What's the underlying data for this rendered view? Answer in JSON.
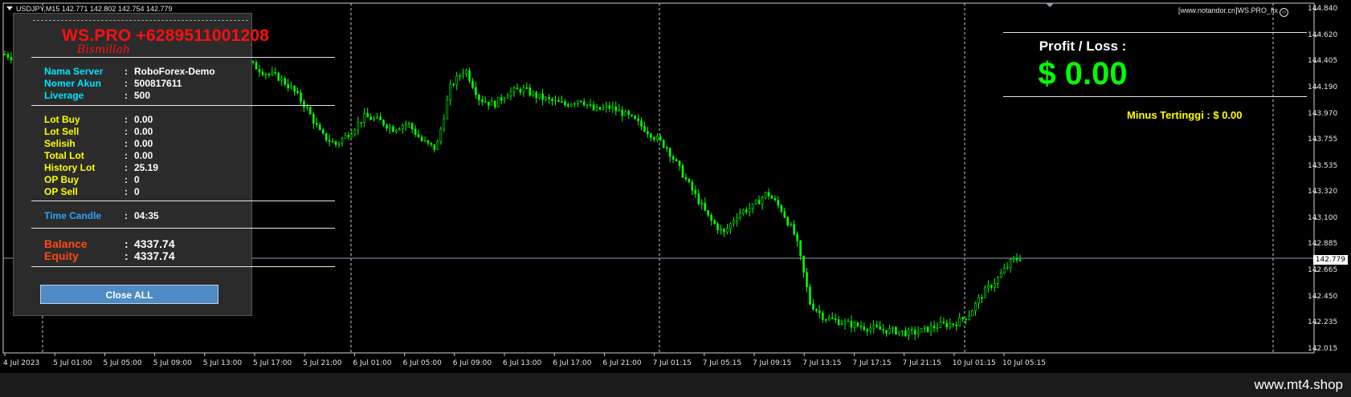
{
  "chart": {
    "symbol_info": "USDJPY,M15  142.771 142.802 142.754 142.779",
    "brand": "[www.notandor.cn]WS.PRO_fix",
    "current_price": "142.779",
    "price_axis": [
      "144.840",
      "144.620",
      "144.405",
      "144.190",
      "143.970",
      "143.755",
      "143.535",
      "143.320",
      "143.100",
      "142.885",
      "142.665",
      "142.450",
      "142.235",
      "142.015"
    ],
    "time_axis": [
      "4 Jul 2023",
      "5 Jul 01:00",
      "5 Jul 05:00",
      "5 Jul 09:00",
      "5 Jul 13:00",
      "5 Jul 17:00",
      "5 Jul 21:00",
      "6 Jul 01:00",
      "6 Jul 05:00",
      "6 Jul 09:00",
      "6 Jul 13:00",
      "6 Jul 17:00",
      "6 Jul 21:00",
      "7 Jul 01:15",
      "7 Jul 05:15",
      "7 Jul 09:15",
      "7 Jul 13:15",
      "7 Jul 17:15",
      "7 Jul 21:15",
      "10 Jul 01:15",
      "10 Jul 05:15"
    ],
    "price_range": [
      142.015,
      144.84
    ],
    "candle_color": "#00ff00",
    "background": "#000000",
    "price_path": [
      [
        0,
        144.47
      ],
      [
        5,
        144.42
      ],
      [
        10,
        144.43
      ],
      [
        15,
        144.38
      ],
      [
        20,
        144.3
      ],
      [
        25,
        144.2
      ],
      [
        30,
        144.28
      ],
      [
        35,
        144.52
      ],
      [
        40,
        144.6
      ],
      [
        45,
        144.62
      ],
      [
        50,
        144.65
      ],
      [
        55,
        144.7
      ],
      [
        60,
        144.66
      ],
      [
        65,
        144.6
      ],
      [
        70,
        144.55
      ],
      [
        75,
        144.58
      ],
      [
        80,
        144.5
      ],
      [
        85,
        144.4
      ],
      [
        90,
        144.32
      ],
      [
        95,
        144.28
      ],
      [
        100,
        144.18
      ],
      [
        105,
        144.02
      ],
      [
        110,
        143.8
      ],
      [
        115,
        143.72
      ],
      [
        120,
        143.82
      ],
      [
        125,
        143.95
      ],
      [
        130,
        143.92
      ],
      [
        135,
        143.85
      ],
      [
        140,
        143.9
      ],
      [
        145,
        143.75
      ],
      [
        150,
        143.68
      ],
      [
        155,
        144.2
      ],
      [
        160,
        144.35
      ],
      [
        165,
        144.1
      ],
      [
        170,
        144.05
      ],
      [
        175,
        144.15
      ],
      [
        180,
        144.18
      ],
      [
        185,
        144.12
      ],
      [
        190,
        144.08
      ],
      [
        195,
        144.05
      ],
      [
        200,
        144.1
      ],
      [
        205,
        144.0
      ],
      [
        210,
        144.03
      ],
      [
        215,
        143.98
      ],
      [
        220,
        143.9
      ],
      [
        225,
        143.8
      ],
      [
        230,
        143.7
      ],
      [
        235,
        143.5
      ],
      [
        240,
        143.3
      ],
      [
        245,
        143.1
      ],
      [
        250,
        142.98
      ],
      [
        255,
        143.15
      ],
      [
        260,
        143.2
      ],
      [
        265,
        143.32
      ],
      [
        270,
        143.18
      ],
      [
        275,
        142.95
      ],
      [
        280,
        142.4
      ],
      [
        285,
        142.28
      ],
      [
        290,
        142.25
      ],
      [
        295,
        142.22
      ],
      [
        300,
        142.2
      ],
      [
        305,
        142.18
      ],
      [
        310,
        142.17
      ],
      [
        315,
        142.15
      ],
      [
        320,
        142.18
      ],
      [
        325,
        142.22
      ],
      [
        330,
        142.23
      ],
      [
        335,
        142.3
      ],
      [
        340,
        142.48
      ],
      [
        345,
        142.6
      ],
      [
        350,
        142.75
      ],
      [
        353,
        142.78
      ]
    ]
  },
  "panel": {
    "title": "WS.PRO +6289511001208",
    "subtitle": "Bismillah",
    "server_label": "Nama Server",
    "server_value": "RoboForex-Demo",
    "account_label": "Nomer Akun",
    "account_value": "500817611",
    "leverage_label": "Liverage",
    "leverage_value": "500",
    "lot_buy_label": "Lot Buy",
    "lot_buy_value": "0.00",
    "lot_sell_label": "Lot Sell",
    "lot_sell_value": "0.00",
    "selisih_label": "Selisih",
    "selisih_value": "0.00",
    "total_lot_label": "Total Lot",
    "total_lot_value": "0.00",
    "history_lot_label": "History Lot",
    "history_lot_value": "25.19",
    "op_buy_label": "OP Buy",
    "op_buy_value": "0",
    "op_sell_label": "OP Sell",
    "op_sell_value": "0",
    "time_candle_label": "Time Candle",
    "time_candle_value": "04:35",
    "balance_label": "Balance",
    "balance_value": "4337.74",
    "equity_label": "Equity",
    "equity_value": "4337.74",
    "close_all_label": "Close ALL",
    "separator": ":"
  },
  "profit": {
    "title": "Profit / Loss :",
    "value": "$ 0.00",
    "minus_label": "Minus Tertinggi  : $ 0.00"
  },
  "footer": {
    "site": "www.mt4.shop"
  }
}
